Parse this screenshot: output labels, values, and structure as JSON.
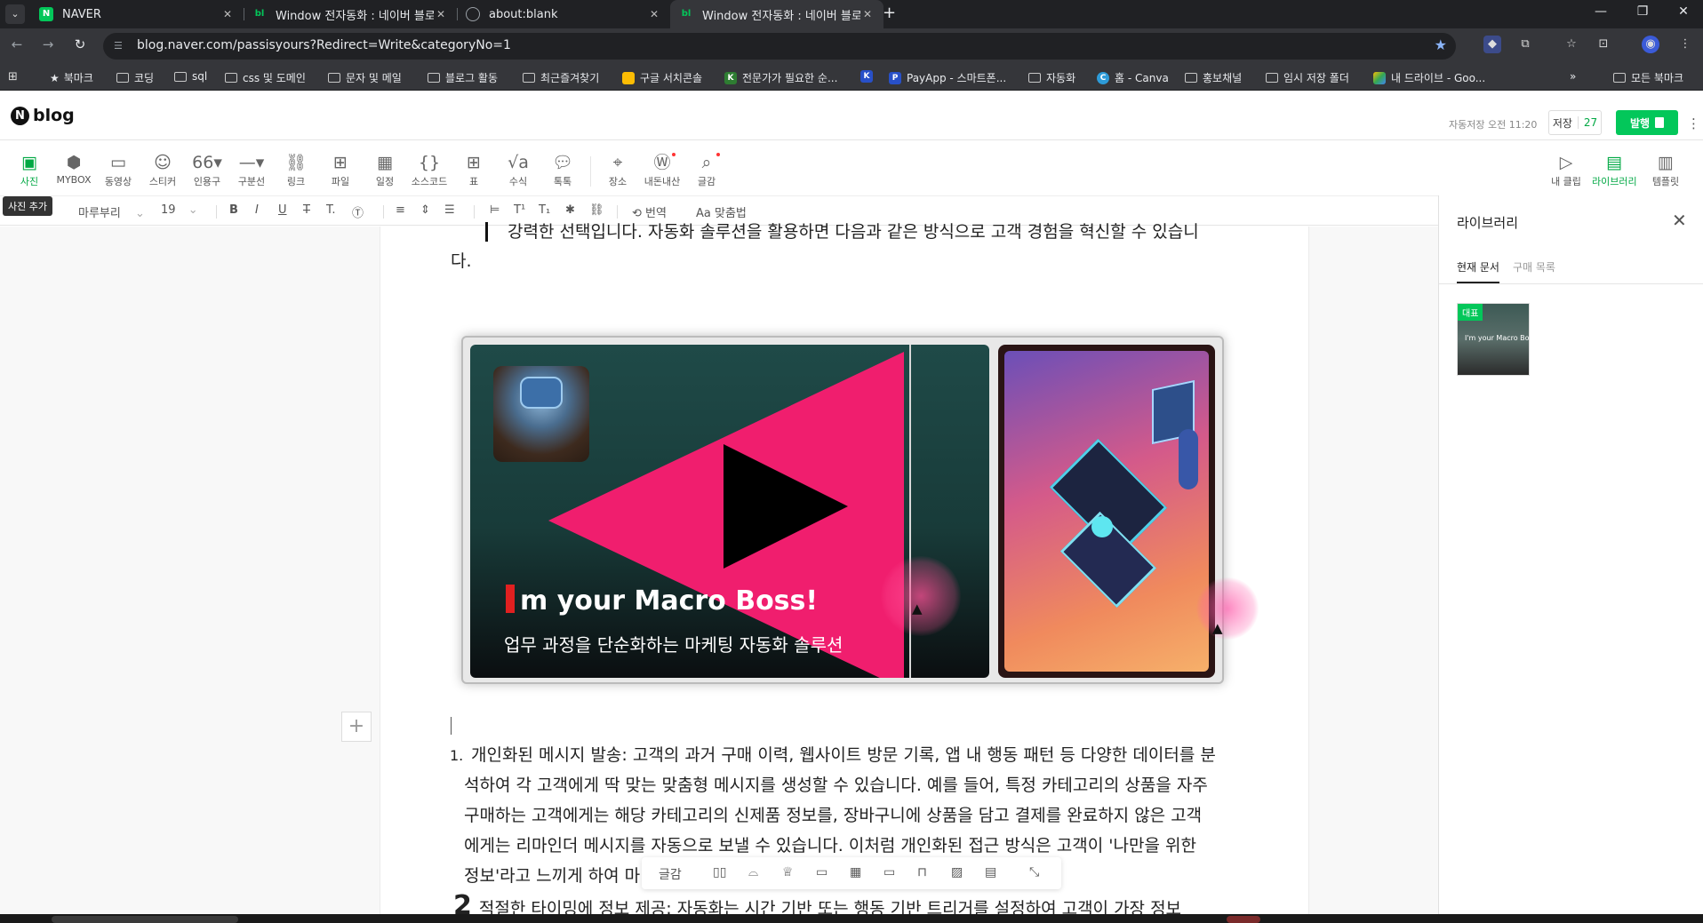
{
  "browser": {
    "tabs": [
      {
        "title": "NAVER",
        "favicon": "N",
        "color": "#03c75a",
        "active": false
      },
      {
        "title": "Window 전자동화 : 네이버 블로그",
        "favicon": "bl",
        "color": "#03c75a",
        "active": false
      },
      {
        "title": "about:blank",
        "favicon": "globe",
        "color": "#9aa0a6",
        "active": false
      },
      {
        "title": "Window 전자동화 : 네이버 블로그",
        "favicon": "bl",
        "color": "#03c75a",
        "active": true
      }
    ],
    "url": "blog.naver.com/passisyours?Redirect=Write&categoryNo=1"
  },
  "bookmarks": {
    "items": [
      {
        "label": "북마크",
        "icon": "star-icon"
      },
      {
        "label": "코딩",
        "icon": "folder-icon"
      },
      {
        "label": "sql",
        "icon": "folder-icon"
      },
      {
        "label": "css 및 도메인",
        "icon": "folder-icon"
      },
      {
        "label": "문자 및 메일",
        "icon": "folder-icon"
      },
      {
        "label": "블로그 활동",
        "icon": "folder-icon"
      },
      {
        "label": "최근즐겨찾기",
        "icon": "folder-icon"
      },
      {
        "label": "구글 서치콘솔",
        "icon": "search-console-icon"
      },
      {
        "label": "전문가가 필요한 순...",
        "icon": "kmong-icon"
      },
      {
        "label": "",
        "icon": "k-icon"
      },
      {
        "label": "PayApp - 스마트폰...",
        "icon": "payapp-icon"
      },
      {
        "label": "자동화",
        "icon": "folder-icon"
      },
      {
        "label": "홈 - Canva",
        "icon": "canva-icon"
      },
      {
        "label": "홍보채널",
        "icon": "folder-icon"
      },
      {
        "label": "임시 저장 폴더",
        "icon": "folder-icon"
      },
      {
        "label": "내 드라이브 - Goo...",
        "icon": "drive-icon"
      }
    ],
    "all_label": "모든 북마크"
  },
  "editor": {
    "logo_text": "blog",
    "autosave": "자동저장 오전 11:20",
    "save_label": "저장",
    "save_count": "27",
    "publish_label": "발행",
    "tooltip": "사진 추가",
    "insert_tools": [
      {
        "label": "사진",
        "icon": "photo-icon",
        "active": true
      },
      {
        "label": "MYBOX",
        "icon": "mybox-icon"
      },
      {
        "label": "동영상",
        "icon": "video-icon"
      },
      {
        "label": "스티커",
        "icon": "sticker-icon"
      },
      {
        "label": "인용구",
        "icon": "quote-icon"
      },
      {
        "label": "구분선",
        "icon": "divider-icon"
      },
      {
        "label": "링크",
        "icon": "link-icon"
      },
      {
        "label": "파일",
        "icon": "file-icon"
      },
      {
        "label": "일정",
        "icon": "calendar-icon"
      },
      {
        "label": "소스코드",
        "icon": "code-icon"
      },
      {
        "label": "표",
        "icon": "table-icon"
      },
      {
        "label": "수식",
        "icon": "formula-icon"
      },
      {
        "label": "톡톡",
        "icon": "talk-icon"
      },
      {
        "label": "장소",
        "icon": "place-icon"
      },
      {
        "label": "내돈내산",
        "icon": "won-icon"
      },
      {
        "label": "글감",
        "icon": "material-icon"
      }
    ],
    "right_tools": [
      {
        "label": "내 클립",
        "icon": "clip-icon"
      },
      {
        "label": "라이브러리",
        "icon": "library-icon",
        "active": true
      },
      {
        "label": "템플릿",
        "icon": "template-icon"
      }
    ],
    "format": {
      "font": "마루부리",
      "size": "19",
      "translate": "번역",
      "spell": "맞춤법"
    }
  },
  "content": {
    "line_top_1": "강력한 선택입니다. 자동화 솔루션을 활용하면 다음과 같은 방식으로 고객 경험을 혁신할 수 있습니",
    "line_top_2": "다.",
    "thumbnail_title_en": "m your Macro Boss!",
    "thumbnail_title_ko": "업무 과정을 단순화하는 마케팅 자동화 솔루션",
    "item1_num": "1.",
    "item1_lines": [
      "개인화된 메시지 발송: 고객의 과거 구매 이력, 웹사이트 방문 기록, 앱 내 행동 패턴 등 다양한 데이터를 분",
      "석하여 각 고객에게 딱 맞는 맞춤형 메시지를 생성할 수 있습니다. 예를 들어, 특정 카테고리의 상품을 자주",
      "구매하는 고객에게는 해당 카테고리의 신제품 정보를, 장바구니에 상품을 담고 결제를 완료하지 않은 고객",
      "에게는 리마인더 메시지를 자동으로 보낼 수 있습니다. 이처럼 개인화된 접근 방식은 고객이 '나만을 위한",
      "정보'라고 느끼게 하여 마"
    ],
    "item2_line": "적절한 타이밍에 정보 제공: 자동화는 시간 기반 또는 행동 기반 트리거를 설정하여 고객이 가장 정보"
  },
  "float_bar": {
    "label": "글감"
  },
  "library": {
    "title": "라이브러리",
    "tab_current": "현재 문서",
    "tab_purchase": "구매 목록",
    "badge": "대표",
    "thumb_text": "I'm your Macro Boss!"
  }
}
